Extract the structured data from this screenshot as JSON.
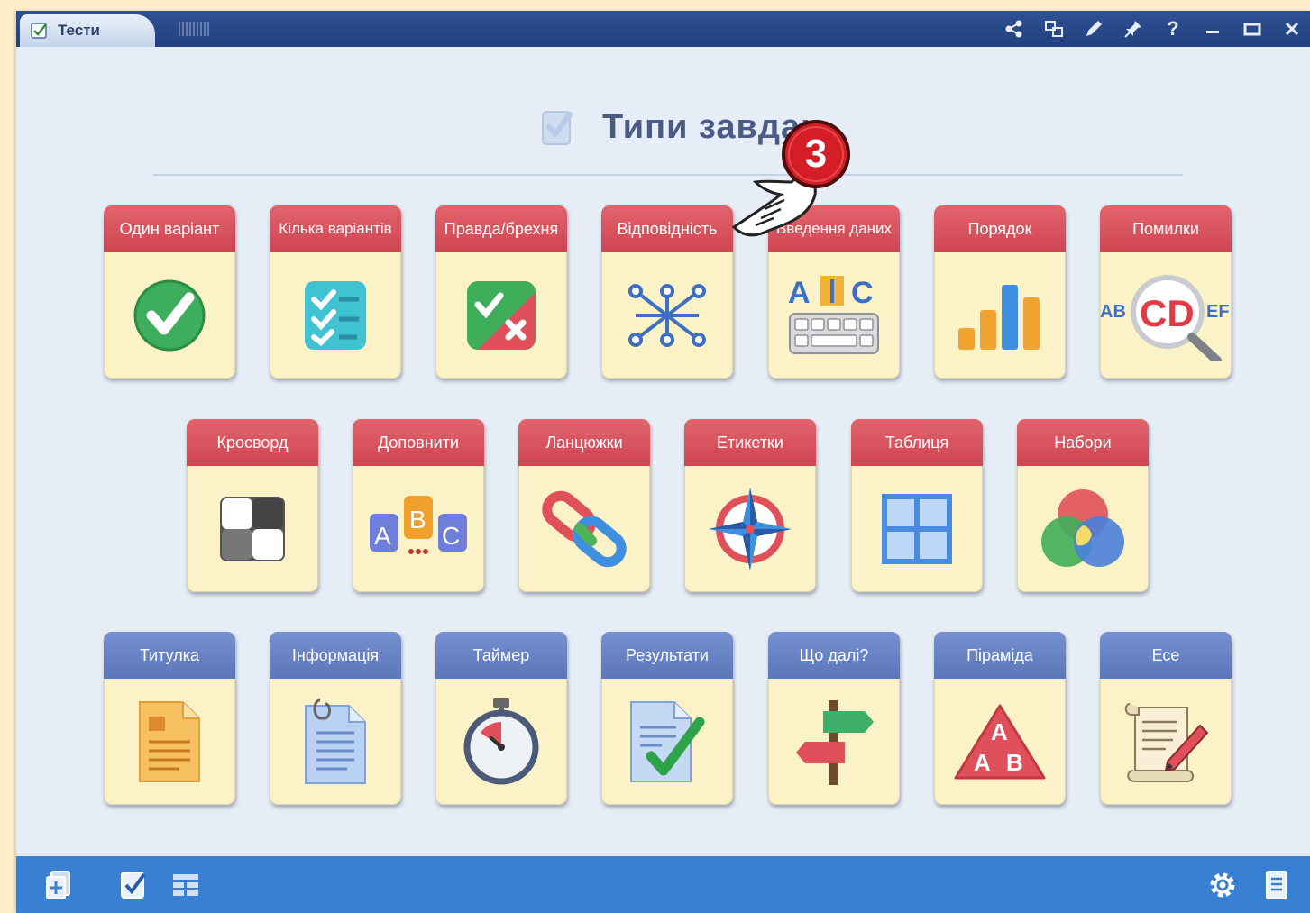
{
  "window": {
    "tab_title": "Тести",
    "controls": [
      "share-icon",
      "network-icon",
      "pencil-icon",
      "pin-icon",
      "help-icon",
      "minimize-icon",
      "maximize-icon",
      "close-icon"
    ]
  },
  "heading": {
    "title": "Типи завдан"
  },
  "rows": [
    [
      {
        "label": "Один варіант",
        "icon": "single-choice-check-icon",
        "color": "red"
      },
      {
        "label": "Кілька варіантів",
        "icon": "multiple-choice-checklist-icon",
        "color": "red"
      },
      {
        "label": "Правда/брехня",
        "icon": "true-false-icon",
        "color": "red"
      },
      {
        "label": "Відповідність",
        "icon": "matching-nodes-icon",
        "color": "red"
      },
      {
        "label": "Введення даних",
        "icon": "text-input-keyboard-icon",
        "color": "red"
      },
      {
        "label": "Порядок",
        "icon": "ordering-bars-icon",
        "color": "red"
      },
      {
        "label": "Помилки",
        "icon": "magnifier-errors-icon",
        "color": "red"
      }
    ],
    [
      {
        "label": "Кросворд",
        "icon": "crossword-icon",
        "color": "red"
      },
      {
        "label": "Доповнити",
        "icon": "fill-blanks-abc-icon",
        "color": "red"
      },
      {
        "label": "Ланцюжки",
        "icon": "chain-links-icon",
        "color": "red"
      },
      {
        "label": "Етикетки",
        "icon": "compass-labels-icon",
        "color": "red"
      },
      {
        "label": "Таблиця",
        "icon": "table-grid-icon",
        "color": "red"
      },
      {
        "label": "Набори",
        "icon": "sets-venn-icon",
        "color": "red"
      }
    ],
    [
      {
        "label": "Титулка",
        "icon": "title-page-icon",
        "color": "blue"
      },
      {
        "label": "Інформація",
        "icon": "information-document-icon",
        "color": "blue"
      },
      {
        "label": "Таймер",
        "icon": "stopwatch-icon",
        "color": "blue"
      },
      {
        "label": "Результати",
        "icon": "results-document-icon",
        "color": "blue"
      },
      {
        "label": "Що далі?",
        "icon": "signpost-icon",
        "color": "blue"
      },
      {
        "label": "Піраміда",
        "icon": "pyramid-icon",
        "color": "blue"
      },
      {
        "label": "Есе",
        "icon": "essay-scroll-icon",
        "color": "blue"
      }
    ]
  ],
  "annotation": {
    "badge_number": "3"
  },
  "bottombar": {
    "left_icons": [
      "add-page-icon",
      "test-check-icon",
      "layout-icon"
    ],
    "right_icons": [
      "settings-gear-icon",
      "list-document-icon"
    ]
  },
  "colors": {
    "header_red": "#d9545e",
    "header_blue": "#6783c4",
    "card_bg": "#fbf3c7",
    "titlebar": "#2a4989",
    "bottombar": "#3a80d2"
  }
}
